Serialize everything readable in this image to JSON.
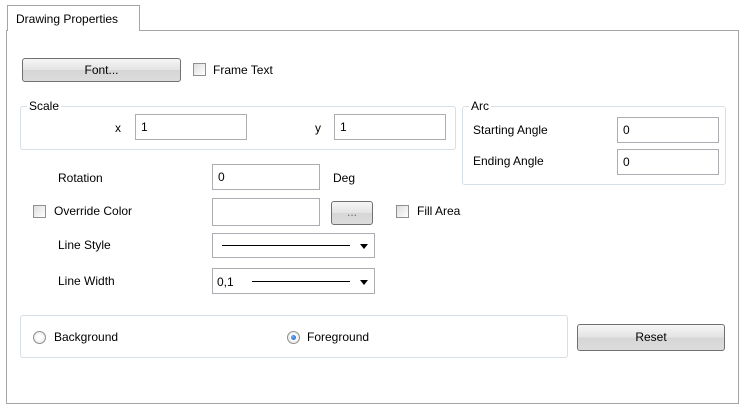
{
  "tab": {
    "label": "Drawing Properties"
  },
  "font_button": {
    "label": "Font..."
  },
  "frame_text": {
    "label": "Frame Text",
    "checked": false
  },
  "scale": {
    "legend": "Scale",
    "x_label": "x",
    "x_value": "1",
    "y_label": "y",
    "y_value": "1"
  },
  "arc": {
    "legend": "Arc",
    "starting_label": "Starting Angle",
    "starting_value": "0",
    "ending_label": "Ending Angle",
    "ending_value": "0"
  },
  "rotation": {
    "label": "Rotation",
    "value": "0",
    "unit": "Deg"
  },
  "override_color": {
    "label": "Override Color",
    "checked": false,
    "value": "",
    "browse_label": "..."
  },
  "fill_area": {
    "label": "Fill Area",
    "checked": false
  },
  "line_style": {
    "label": "Line Style",
    "selected": "solid"
  },
  "line_width": {
    "label": "Line Width",
    "selected": "0,1"
  },
  "layer": {
    "background_label": "Background",
    "foreground_label": "Foreground",
    "selected": "Foreground"
  },
  "reset_button": {
    "label": "Reset"
  },
  "colors": {
    "border": "#a5a5a5",
    "group_border": "#d5dfe5",
    "radio_selected": "#1a56b8"
  }
}
